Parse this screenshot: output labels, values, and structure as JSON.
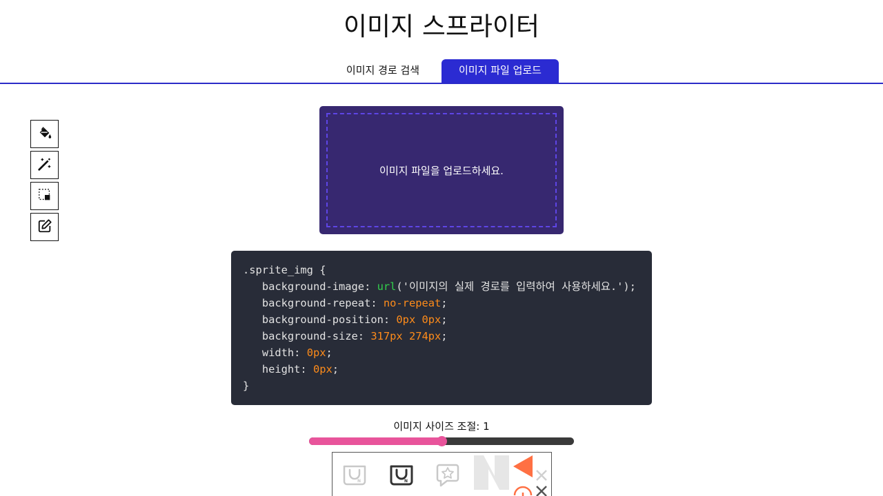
{
  "header": {
    "title": "이미지 스프라이터"
  },
  "tabs": [
    {
      "label": "이미지 경로 검색",
      "active": false
    },
    {
      "label": "이미지 파일 업로드",
      "active": true
    }
  ],
  "toolbar": {
    "items": [
      {
        "icon": "paint-bucket-icon"
      },
      {
        "icon": "magic-wand-icon"
      },
      {
        "icon": "selection-icon"
      },
      {
        "icon": "edit-icon"
      }
    ]
  },
  "upload": {
    "prompt": "이미지 파일을 업로드하세요."
  },
  "code": {
    "selector": ".sprite_img {",
    "bg_image_prop": "background-image: ",
    "bg_image_fn": "url",
    "bg_image_arg": "('이미지의 실제 경로를 입력하여 사용하세요.');",
    "bg_repeat_prop": "background-repeat: ",
    "bg_repeat_val": "no-repeat",
    "bg_position_prop": "background-position: ",
    "bg_position_val": "0px 0px",
    "bg_size_prop": "background-size: ",
    "bg_size_val": "317px 274px",
    "width_prop": "width: ",
    "width_val": "0px",
    "height_prop": "height: ",
    "height_val": "0px",
    "semicolon": ";",
    "closing": "}"
  },
  "size_control": {
    "label": "이미지 사이즈 조절: 1",
    "value_fraction": 0.5
  },
  "colors": {
    "accent": "#2b2bd2",
    "dropzone": "#372870",
    "slider": "#e8549b",
    "code_bg": "#282c38"
  }
}
